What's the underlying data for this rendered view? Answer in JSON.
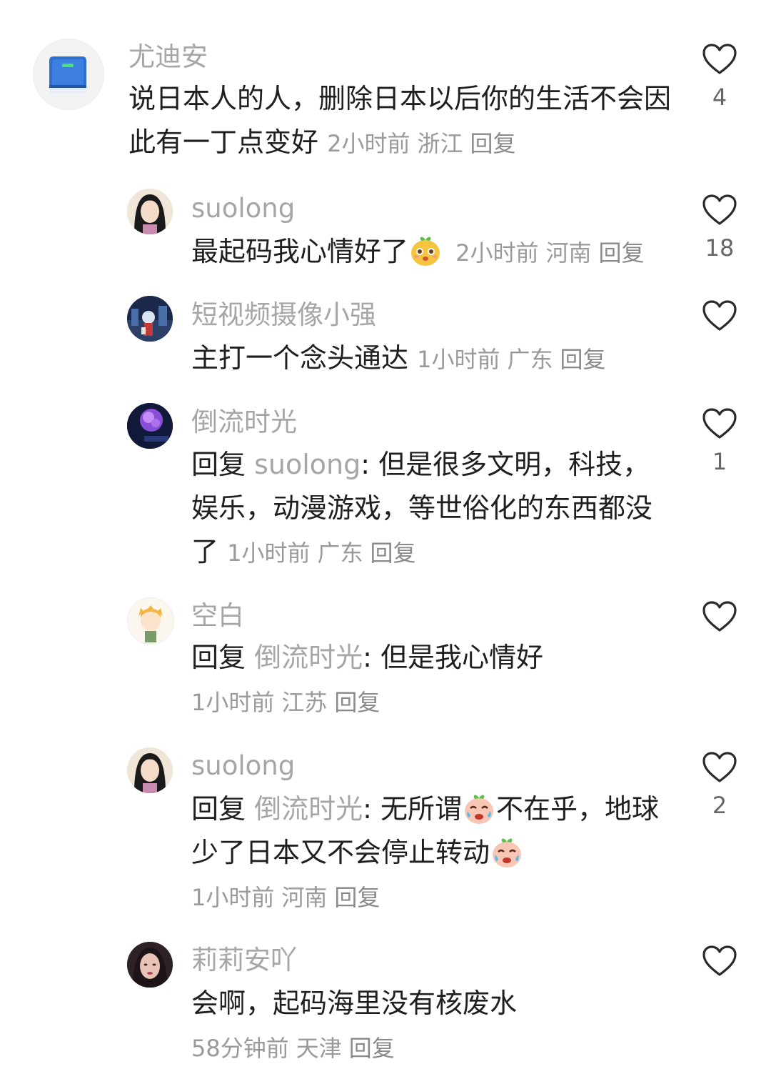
{
  "comments": [
    {
      "username": "尤迪安",
      "text": "说日本人的人，删除日本以后你的生活不会因此有一丁点变好",
      "time": "2小时前",
      "location": "浙江",
      "reply": "回复",
      "likes": "4",
      "avatar_icon": "book-icon"
    },
    {
      "username": "suolong",
      "text": "最起码我心情好了",
      "emoji": "happy-face-icon",
      "time": "2小时前",
      "location": "河南",
      "reply": "回复",
      "likes": "18"
    },
    {
      "username": "短视频摄像小强",
      "text": "主打一个念头通达",
      "time": "1小时前",
      "location": "广东",
      "reply": "回复",
      "likes": ""
    },
    {
      "username": "倒流时光",
      "reply_prefix": "回复",
      "reply_to": "suolong",
      "text": ": 但是很多文明，科技，娱乐，动漫游戏，等世俗化的东西都没了",
      "time": "1小时前",
      "location": "广东",
      "reply": "回复",
      "likes": "1"
    },
    {
      "username": "空白",
      "reply_prefix": "回复",
      "reply_to": "倒流时光",
      "text": ": 但是我心情好",
      "time": "1小时前",
      "location": "江苏",
      "reply": "回复",
      "likes": ""
    },
    {
      "username": "suolong",
      "reply_prefix": "回复",
      "reply_to": "倒流时光",
      "text_part1": ": 无所谓",
      "text_part2": "不在乎，地球少了日本又不会停止转动",
      "emoji": "crying-face-icon",
      "time": "1小时前",
      "location": "河南",
      "reply": "回复",
      "likes": "2"
    },
    {
      "username": "莉莉安吖",
      "text": "会啊，起码海里没有核废水",
      "time": "58分钟前",
      "location": "天津",
      "reply": "回复",
      "likes": ""
    }
  ],
  "colors": {
    "username": "#a6a6a6",
    "text": "#1f1f1f",
    "meta": "#9a9a9a",
    "heart": "#2a2a2a",
    "book_blue": "#2f6fd0"
  }
}
